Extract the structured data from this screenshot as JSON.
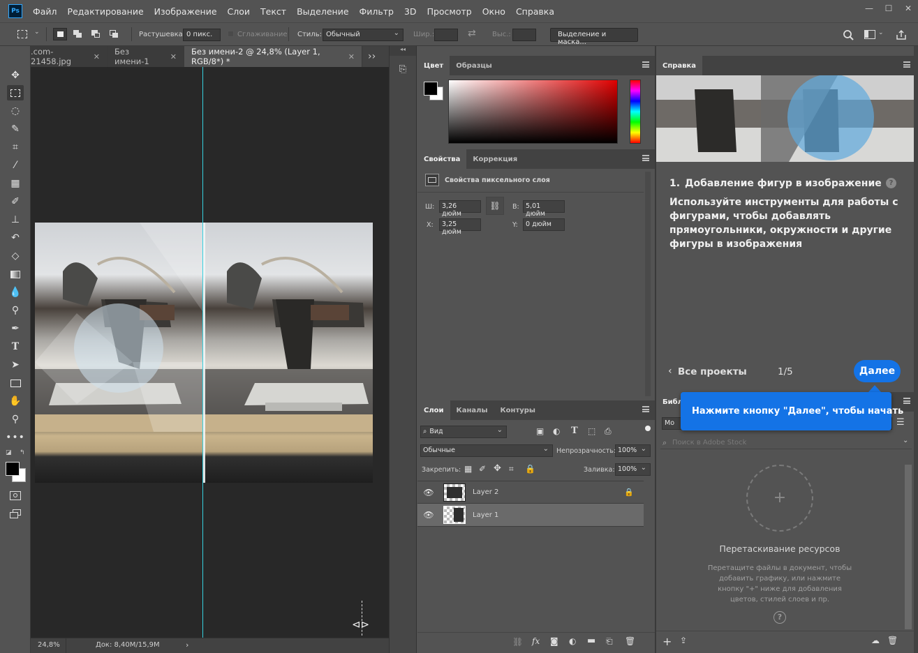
{
  "app": {
    "logo_text": "Ps"
  },
  "menu": [
    "Файл",
    "Редактирование",
    "Изображение",
    "Слои",
    "Текст",
    "Выделение",
    "Фильтр",
    "3D",
    "Просмотр",
    "Окно",
    "Справка"
  ],
  "window_controls": {
    "minimize": "—",
    "maximize": "☐",
    "close": "✕"
  },
  "options": {
    "feather_label": "Растушевка:",
    "feather_value": "0 пикс.",
    "antialias_label": "Сглаживание",
    "style_label": "Стиль:",
    "style_value": "Обычный",
    "width_label": "Шир.:",
    "height_label": "Выс.:",
    "select_mask_button": "Выделение и маска..."
  },
  "tabs": [
    {
      "label": ".com-21458.jpg",
      "close": "✕"
    },
    {
      "label": "Без имени-1",
      "close": "✕"
    },
    {
      "label": "Без имени-2 @ 24,8% (Layer 1, RGB/8*) *",
      "close": "✕"
    }
  ],
  "tabs_overflow": "››",
  "status": {
    "zoom": "24,8%",
    "doc": "Док: 8,40M/15,9M",
    "arrow": "›"
  },
  "color_panel": {
    "tabs": [
      "Цвет",
      "Образцы"
    ],
    "foreground": "#000000",
    "background": "#ffffff"
  },
  "properties_panel": {
    "tabs": [
      "Свойства",
      "Коррекция"
    ],
    "title": "Свойства пиксельного слоя",
    "w_label": "Ш:",
    "w_value": "3,26 дюйм",
    "h_label": "В:",
    "h_value": "5,01 дюйм",
    "x_label": "X:",
    "x_value": "3,25 дюйм",
    "y_label": "Y:",
    "y_value": "0 дюйм"
  },
  "layers_panel": {
    "tabs": [
      "Слои",
      "Каналы",
      "Контуры"
    ],
    "filter_value": "Вид",
    "blend_mode": "Обычные",
    "opacity_label": "Непрозрачность:",
    "opacity_value": "100%",
    "lock_label": "Закрепить:",
    "fill_label": "Заливка:",
    "fill_value": "100%",
    "layers": [
      {
        "name": "Layer 2",
        "locked": true,
        "selected": false
      },
      {
        "name": "Layer 1",
        "locked": false,
        "selected": true
      }
    ]
  },
  "help_panel": {
    "tab": "Справка",
    "step_number": "1.",
    "step_title": "Добавление фигур в изображение",
    "description": "Используйте инструменты для работы с фигурами, чтобы добавлять прямоугольники, окружности и другие фигуры в изображения",
    "back_link": "Все проекты",
    "progress": "1/5",
    "next_button": "Далее",
    "help_icon": "?"
  },
  "tooltip": {
    "text": "Нажмите кнопку \"Далее\", чтобы начать"
  },
  "libraries_panel": {
    "tab": "Библ",
    "dropdown_value": "Мо",
    "search_placeholder": "Поиск в Adobe Stock",
    "drop_title": "Перетаскивание ресурсов",
    "drop_text": "Перетащите файлы в документ, чтобы добавить графику, или нажмите кнопку \"+\" ниже для добавления цветов, стилей слоев и пр.",
    "help_icon": "?",
    "plus": "+"
  }
}
